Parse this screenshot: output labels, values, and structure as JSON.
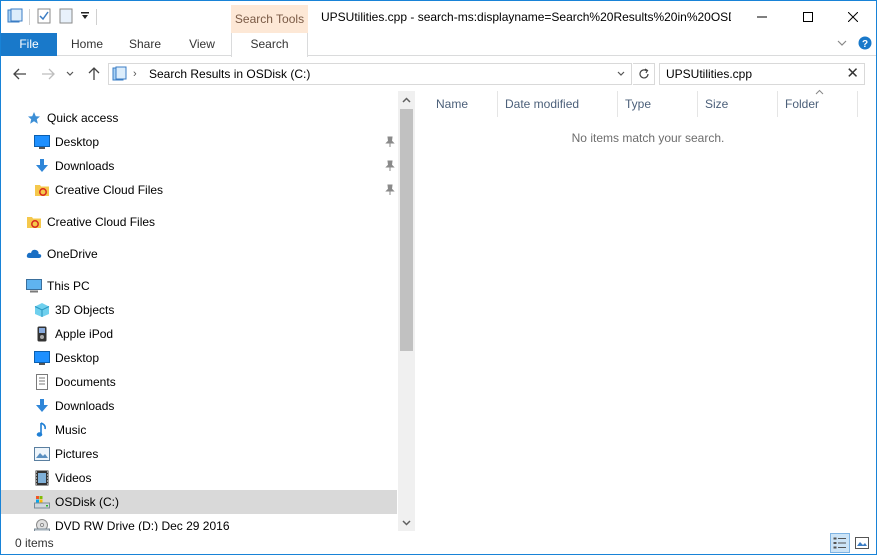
{
  "window": {
    "title": "UPSUtilities.cpp - search-ms:displayname=Search%20Results%20in%20OSD..."
  },
  "ribbon": {
    "context_tab": "Search Tools",
    "tabs": [
      {
        "label": "File"
      },
      {
        "label": "Home"
      },
      {
        "label": "Share"
      },
      {
        "label": "View"
      },
      {
        "label": "Search"
      }
    ]
  },
  "address": {
    "path": "Search Results in OSDisk (C:)"
  },
  "search": {
    "value": "UPSUtilities.cpp"
  },
  "nav": {
    "items": [
      {
        "label": "Quick access",
        "icon": "star-icon"
      },
      {
        "label": "Desktop",
        "icon": "desktop-icon",
        "pinned": true
      },
      {
        "label": "Downloads",
        "icon": "download-icon",
        "pinned": true
      },
      {
        "label": "Creative Cloud Files",
        "icon": "creative-cloud-folder-icon",
        "pinned": true
      },
      {
        "label": "Creative Cloud Files",
        "icon": "creative-cloud-folder-icon"
      },
      {
        "label": "OneDrive",
        "icon": "cloud-icon"
      },
      {
        "label": "This PC",
        "icon": "computer-icon"
      },
      {
        "label": "3D Objects",
        "icon": "cube-icon"
      },
      {
        "label": "Apple iPod",
        "icon": "ipod-icon"
      },
      {
        "label": "Desktop",
        "icon": "desktop-icon"
      },
      {
        "label": "Documents",
        "icon": "document-icon"
      },
      {
        "label": "Downloads",
        "icon": "download-icon"
      },
      {
        "label": "Music",
        "icon": "music-note-icon"
      },
      {
        "label": "Pictures",
        "icon": "picture-icon"
      },
      {
        "label": "Videos",
        "icon": "film-icon"
      },
      {
        "label": "OSDisk (C:)",
        "icon": "drive-icon",
        "selected": true
      },
      {
        "label": "DVD RW Drive (D:) Dec 29 2016",
        "icon": "dvd-drive-icon"
      }
    ]
  },
  "columns": [
    {
      "label": "Name"
    },
    {
      "label": "Date modified"
    },
    {
      "label": "Type"
    },
    {
      "label": "Size"
    },
    {
      "label": "Folder"
    }
  ],
  "content": {
    "empty_message": "No items match your search."
  },
  "status": {
    "item_count": "0 items"
  },
  "colors": {
    "accent": "#1979ca",
    "context_tab": "#fde8d6",
    "selected_row": "#d9d9d9"
  }
}
